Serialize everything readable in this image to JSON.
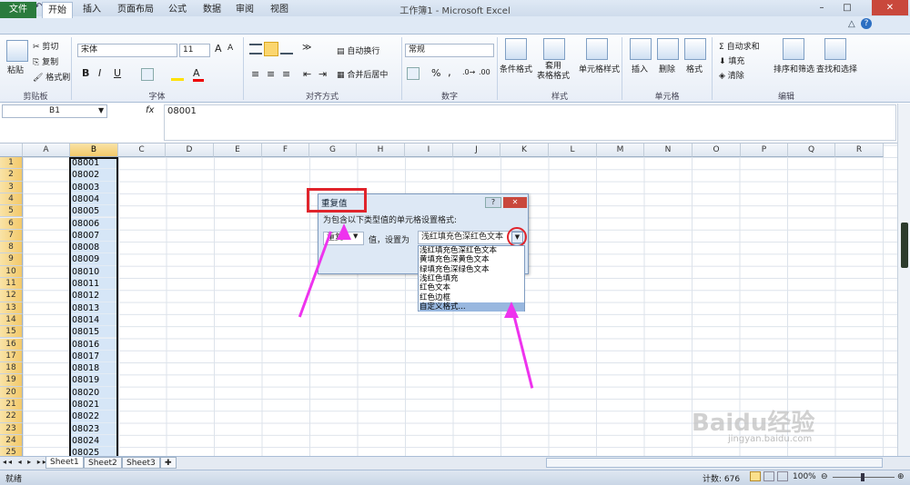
{
  "window": {
    "title": "工作簿1 - Microsoft Excel",
    "minimize": "–",
    "maximize": "□",
    "close": "✕"
  },
  "tabs": {
    "file": "文件",
    "items": [
      "开始",
      "插入",
      "页面布局",
      "公式",
      "数据",
      "审阅",
      "视图"
    ]
  },
  "ribbon": {
    "clipboard": {
      "paste": "粘贴",
      "cut": "剪切",
      "copy": "复制",
      "painter": "格式刷",
      "label": "剪贴板"
    },
    "font": {
      "name": "宋体",
      "size": "11",
      "bold": "B",
      "italic": "I",
      "underline": "U",
      "label": "字体",
      "grow": "A",
      "shrink": "A"
    },
    "align": {
      "wrap": "自动换行",
      "merge": "合并后居中",
      "label": "对齐方式"
    },
    "number": {
      "format": "常规",
      "percent": "%",
      "comma": ",",
      "label": "数字"
    },
    "styles": {
      "cond": "条件格式",
      "table": "套用\n表格格式",
      "cell": "单元格样式",
      "label": "样式"
    },
    "cells": {
      "insert": "插入",
      "delete": "删除",
      "format": "格式",
      "label": "单元格"
    },
    "edit": {
      "sum": "自动求和",
      "fill": "填充",
      "clear": "清除",
      "sort": "排序和筛选",
      "find": "查找和选择",
      "label": "编辑"
    }
  },
  "formula": {
    "namebox": "B1",
    "fx": "fx",
    "value": "08001"
  },
  "columns": [
    "A",
    "B",
    "C",
    "D",
    "E",
    "F",
    "G",
    "H",
    "I",
    "J",
    "K",
    "L",
    "M",
    "N",
    "O",
    "P",
    "Q",
    "R"
  ],
  "rows": [
    "1",
    "2",
    "3",
    "4",
    "5",
    "6",
    "7",
    "8",
    "9",
    "10",
    "11",
    "12",
    "13",
    "14",
    "15",
    "16",
    "17",
    "18",
    "19",
    "20",
    "21",
    "22",
    "23",
    "24",
    "25"
  ],
  "cells": [
    "08001",
    "08002",
    "08003",
    "08004",
    "08005",
    "08006",
    "08007",
    "08008",
    "08009",
    "08010",
    "08011",
    "08012",
    "08013",
    "08014",
    "08015",
    "08016",
    "08017",
    "08018",
    "08019",
    "08020",
    "08021",
    "08022",
    "08023",
    "08024",
    "08025"
  ],
  "dialog": {
    "title": "重复值",
    "help": "?",
    "close": "✕",
    "prompt": "为包含以下类型值的单元格设置格式:",
    "type": "重复",
    "value_label": "值，设置为",
    "format": "浅红填充色深红色文本",
    "options": [
      "浅红填充色深红色文本",
      "黄填充色深黄色文本",
      "绿填充色深绿色文本",
      "浅红色填充",
      "红色文本",
      "红色边框",
      "自定义格式..."
    ]
  },
  "sheets": [
    "Sheet1",
    "Sheet2",
    "Sheet3"
  ],
  "status": {
    "ready": "就绪",
    "count": "计数: 676",
    "zoom": "100%"
  },
  "watermark": "Baidu经验",
  "watermark_url": "jingyan.baidu.com"
}
